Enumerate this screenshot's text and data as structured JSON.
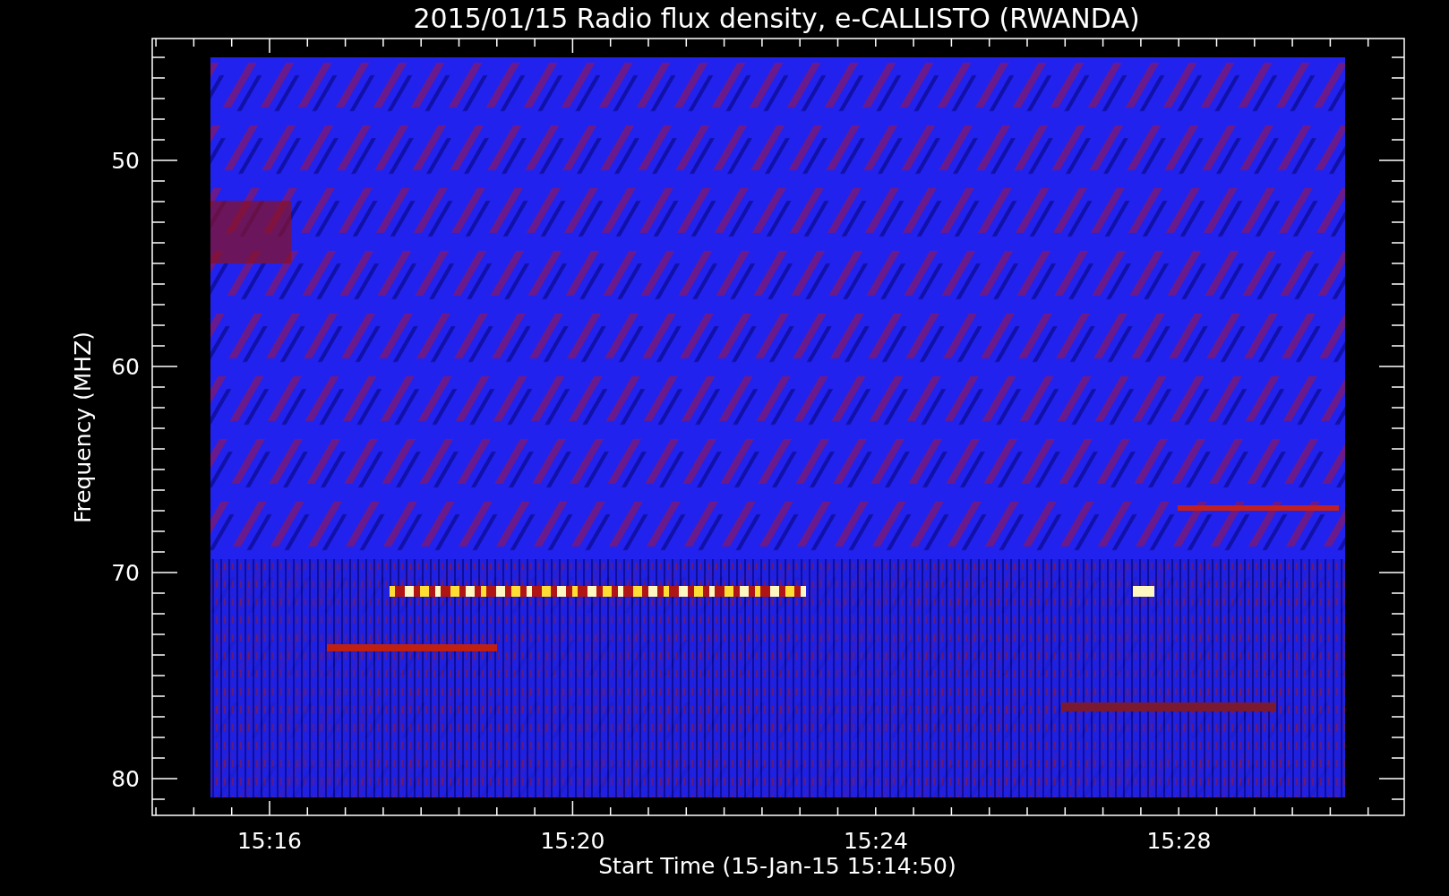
{
  "title": "2015/01/15  Radio flux density, e-CALLISTO (RWANDA)",
  "ylabel": "Frequency (MHZ)",
  "xlabel": "Start Time (15-Jan-15 15:14:50)",
  "yticks": [
    "50",
    "60",
    "70",
    "80"
  ],
  "xticks": [
    "15:16",
    "15:20",
    "15:24",
    "15:28"
  ]
}
